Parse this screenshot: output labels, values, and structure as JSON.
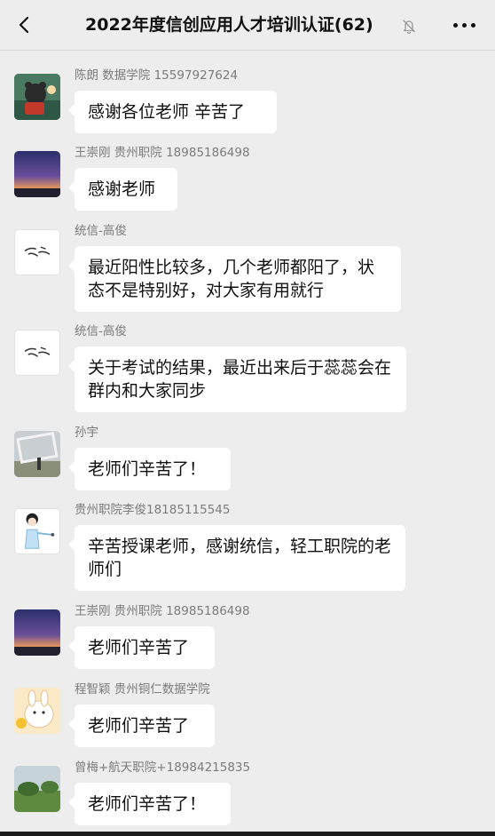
{
  "header": {
    "title": "2022年度信创应用人才培训认证(62)",
    "back_icon": "chevron-left-icon",
    "mute_icon": "bell-off-icon",
    "more_icon": "more-horizontal-icon"
  },
  "messages": [
    {
      "sender": "陈朗 数据学院 15597927624",
      "text": "感谢各位老师 辛苦了"
    },
    {
      "sender": "王崇刚 贵州职院 18985186498",
      "text": "感谢老师"
    },
    {
      "sender": "统信-高俊",
      "text": "最近阳性比较多，几个老师都阳了，状态不是特别好，对大家有用就行"
    },
    {
      "sender": "统信-高俊",
      "text": "关于考试的结果，最近出来后于蕊蕊会在群内和大家同步"
    },
    {
      "sender": "孙宇",
      "text": "老师们辛苦了！"
    },
    {
      "sender": "贵州职院李俊18185115545",
      "text": "辛苦授课老师，感谢统信，轻工职院的老师们"
    },
    {
      "sender": "王崇刚 贵州职院 18985186498",
      "text": "老师们辛苦了"
    },
    {
      "sender": "程智颖  贵州铜仁数据学院",
      "text": "老师们辛苦了"
    },
    {
      "sender": "曾梅+航天职院+18984215835",
      "text": "老师们辛苦了！"
    }
  ]
}
